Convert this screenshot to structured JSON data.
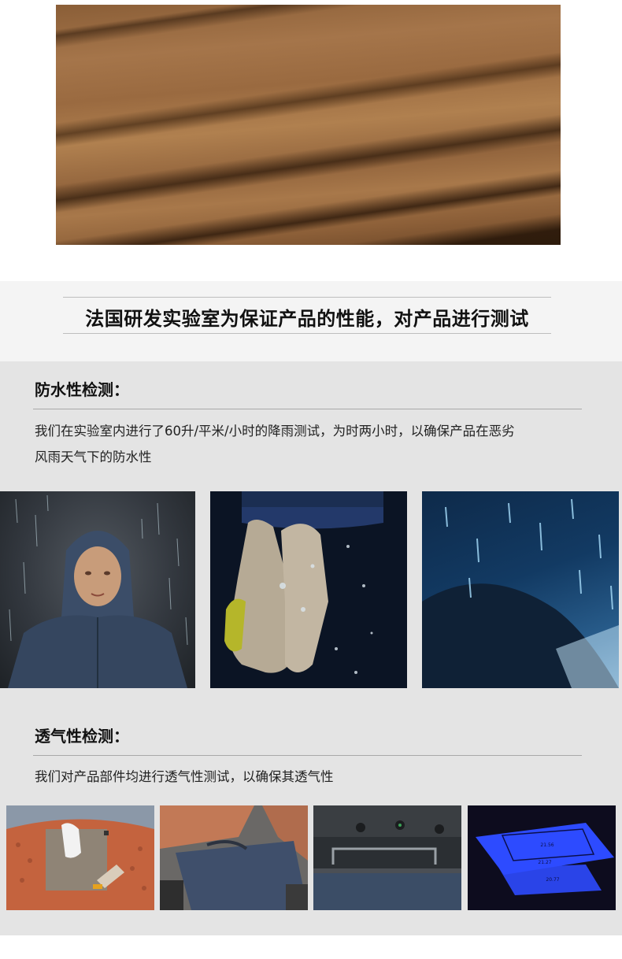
{
  "hero": {
    "image": "brown-wool-fabric-folds"
  },
  "banner": {
    "headline": "法国研发实验室为保证产品的性能，对产品进行测试"
  },
  "waterproof": {
    "title": "防水性检测：",
    "description_line1": "我们在实验室内进行了60升/平米/小时的降雨测试，为时两小时，以确保产品在恶劣",
    "description_line2": "风雨天气下的防水性",
    "photos": [
      "mannequin-rain-jacket",
      "hand-water-drops",
      "rain-splash-on-fabric"
    ]
  },
  "breathability": {
    "title": "透气性检测：",
    "description": "我们对产品部件均进行透气性测试，以确保其透气性",
    "photos": [
      "fabric-cutting-template",
      "sewing-fabric",
      "lab-equipment",
      "blue-test-panel"
    ],
    "panel_readings": [
      "21.56",
      "21.27",
      "20.77"
    ]
  },
  "colors": {
    "band": "#f4f4f4",
    "section": "#e4e4e4",
    "fabric": "#a5754a"
  }
}
